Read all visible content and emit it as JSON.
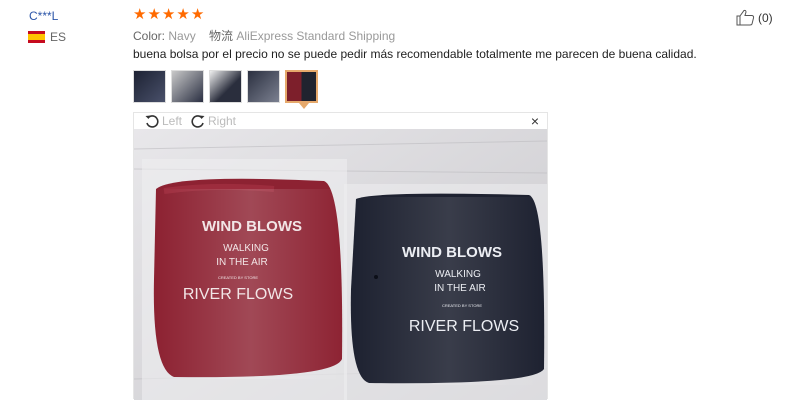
{
  "review": {
    "user": "C***L",
    "country": "ES",
    "stars": 5,
    "color_label": "Color:",
    "color_value": "Navy",
    "shipping_label": "物流",
    "shipping_value": "AliExpress Standard Shipping",
    "text": "buena bolsa por el precio no se puede pedir más recomendable totalmente me parecen de buena calidad.",
    "likes": "(0)"
  },
  "viewer": {
    "rotate_left": "Left",
    "rotate_right": "Right",
    "close": "×"
  },
  "photo": {
    "bag_left": {
      "line1": "WIND BLOWS",
      "line2": "WALKING",
      "line3": "IN THE AIR",
      "small": "CREATED BY STORE",
      "line4": "RIVER FLOWS"
    },
    "bag_right": {
      "line1": "WIND BLOWS",
      "line2": "WALKING",
      "line3": "IN THE AIR",
      "small": "CREATED BY STORE",
      "line4": "RIVER FLOWS"
    }
  },
  "colors": {
    "star": "#ff6a00",
    "username": "#2b55a8",
    "active_thumb": "#e6a96c",
    "bag_red": "#8d2232",
    "bag_navy": "#1e2231"
  }
}
